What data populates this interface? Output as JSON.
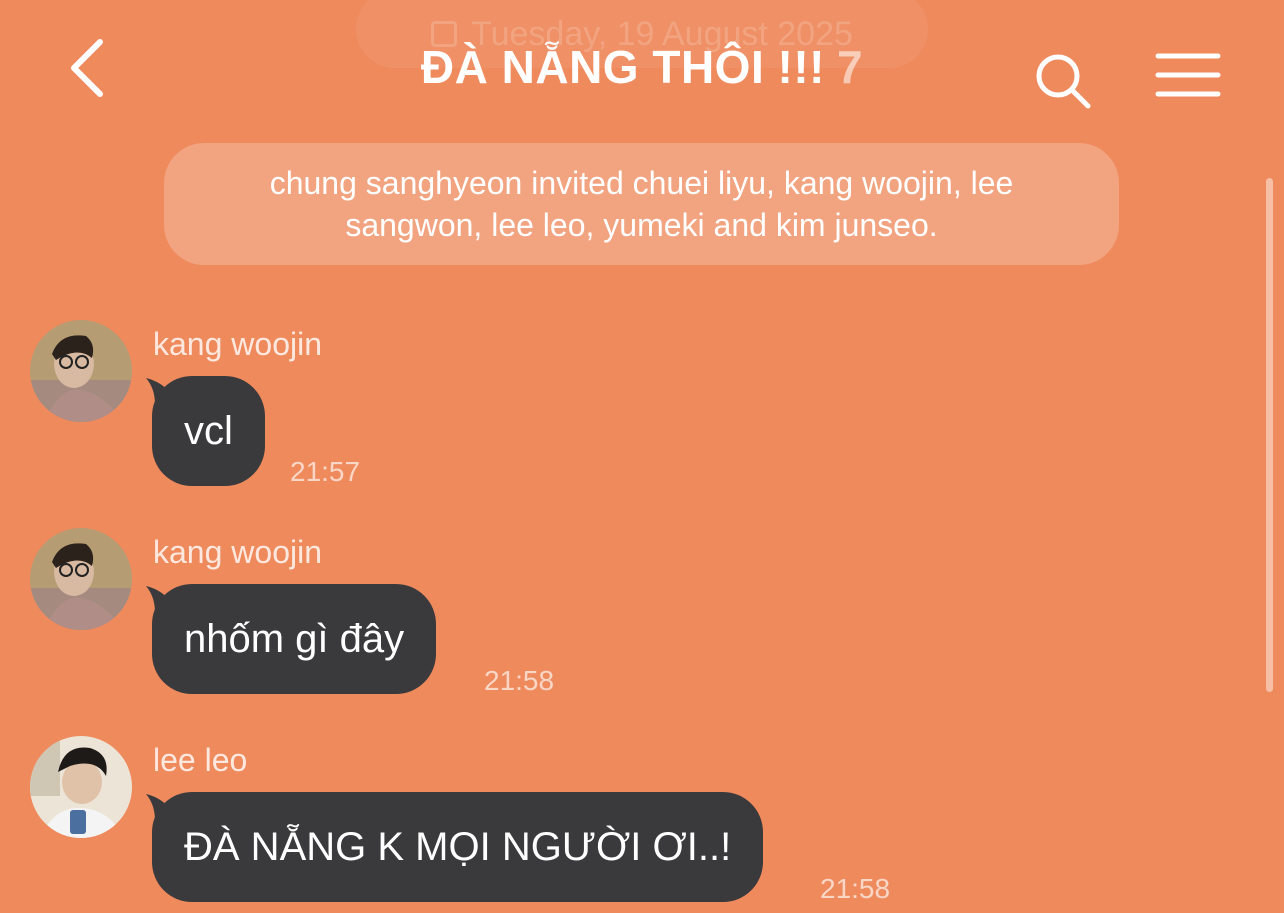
{
  "header": {
    "date_label": "Tuesday, 19 August 2025",
    "title": "ĐÀ NẴNG THÔI !!!",
    "member_count": "7",
    "back_icon": "chevron-left-icon",
    "search_icon": "search-icon",
    "menu_icon": "hamburger-menu-icon"
  },
  "system_notice": "chung sanghyeon invited chuei liyu, kang woojin, lee sangwon, lee leo, yumeki and kim junseo.",
  "messages": [
    {
      "sender": "kang woojin",
      "text": "vcl",
      "time": "21:57"
    },
    {
      "sender": "kang woojin",
      "text": "nhốm gì đây",
      "time": "21:58"
    },
    {
      "sender": "lee leo",
      "text": "ĐÀ NẴNG K MỌI NGƯỜI ƠI..!",
      "time": "21:58"
    }
  ],
  "colors": {
    "background": "#ef8a5d",
    "bubble": "#3a3a3c",
    "text": "#ffffff"
  }
}
